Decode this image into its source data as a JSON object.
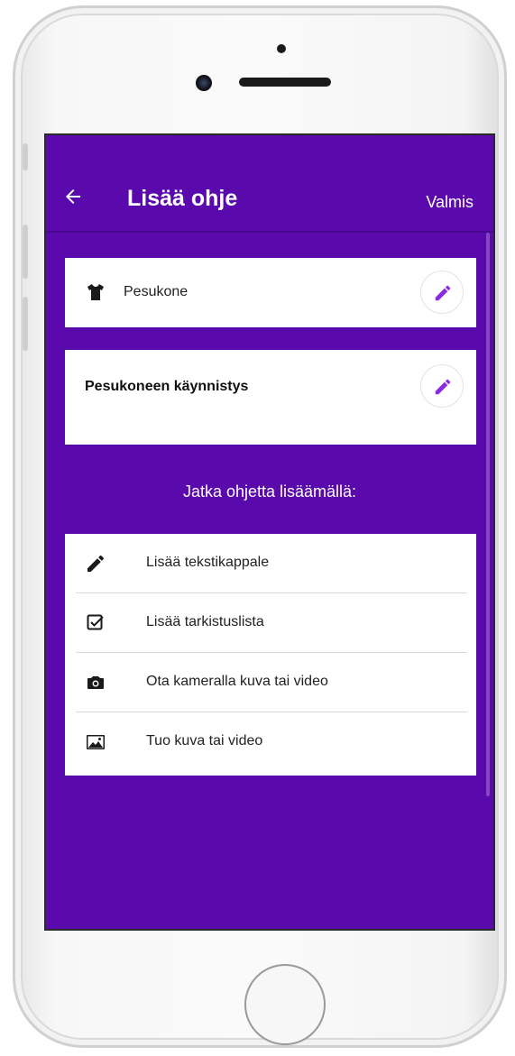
{
  "appbar": {
    "title": "Lisää ohje",
    "done_label": "Valmis",
    "back_icon": "arrow-left-icon"
  },
  "category_card": {
    "icon": "shirt-icon",
    "label": "Pesukone",
    "edit_icon": "pencil-icon"
  },
  "title_card": {
    "label": "Pesukoneen käynnistys",
    "edit_icon": "pencil-icon"
  },
  "continue_prompt": "Jatka ohjetta lisäämällä:",
  "options": [
    {
      "icon": "pencil-icon",
      "label": "Lisää tekstikappale"
    },
    {
      "icon": "checkbox-icon",
      "label": "Lisää tarkistuslista"
    },
    {
      "icon": "camera-icon",
      "label": "Ota kameralla kuva tai video"
    },
    {
      "icon": "image-icon",
      "label": "Tuo kuva tai video"
    }
  ],
  "colors": {
    "primary": "#5a0aac",
    "accent": "#8a2be2",
    "surface": "#ffffff"
  }
}
